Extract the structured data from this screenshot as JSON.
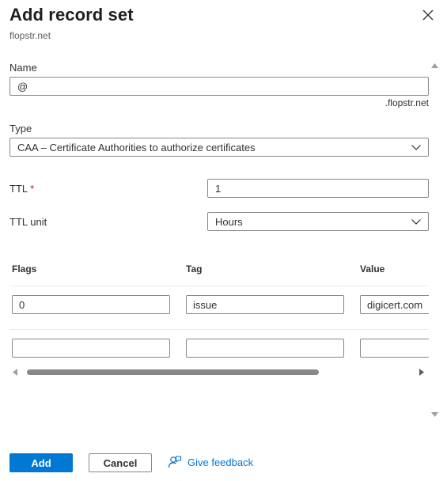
{
  "header": {
    "title": "Add record set",
    "subtitle": "flopstr.net"
  },
  "form": {
    "name": {
      "label": "Name",
      "value": "@",
      "suffix": ".flopstr.net"
    },
    "type": {
      "label": "Type",
      "value": "CAA – Certificate Authorities to authorize certificates"
    },
    "ttl": {
      "label": "TTL",
      "required_mark": "*",
      "value": "1"
    },
    "ttl_unit": {
      "label": "TTL unit",
      "value": "Hours"
    }
  },
  "grid": {
    "columns": [
      "Flags",
      "Tag",
      "Value"
    ],
    "rows": [
      {
        "flags": "0",
        "tag": "issue",
        "value": "digicert.com"
      },
      {
        "flags": "",
        "tag": "",
        "value": ""
      }
    ]
  },
  "footer": {
    "add_label": "Add",
    "cancel_label": "Cancel",
    "feedback_label": "Give feedback"
  },
  "icons": {
    "close": "close-icon",
    "dropdown": "chevron-down-icon",
    "feedback": "feedback-icon"
  },
  "colors": {
    "primary": "#0078d4",
    "required": "#a4262c",
    "border": "#8a8886"
  }
}
